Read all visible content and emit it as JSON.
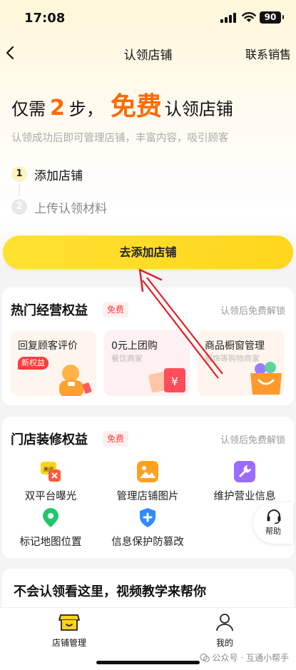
{
  "status_bar": {
    "time": "17:08",
    "battery": "90"
  },
  "nav": {
    "title": "认领店铺",
    "contact": "联系销售"
  },
  "hero": {
    "headline_pre": "仅需",
    "headline_num": "2",
    "headline_mid": "步，",
    "headline_free": "免费",
    "headline_post": "认领店铺",
    "subtitle": "认领成功后即可管理店铺，丰富内容，吸引顾客"
  },
  "steps": [
    {
      "num": "1",
      "label": "添加店铺"
    },
    {
      "num": "2",
      "label": "上传认领材料"
    }
  ],
  "cta": {
    "label": "去添加店铺"
  },
  "hot_benefits": {
    "title": "热门经营权益",
    "badge": "免费",
    "unlock": "认领后免费解锁",
    "tiles": [
      {
        "title": "回复顾客评价",
        "tag": "新权益"
      },
      {
        "title": "0元上团购",
        "subtitle": "餐饮商家"
      },
      {
        "title": "商品橱窗管理",
        "subtitle": "服饰等购物商家"
      }
    ]
  },
  "decor_benefits": {
    "title": "门店装修权益",
    "badge": "免费",
    "unlock": "认领后免费解锁",
    "items": [
      {
        "label": "双平台曝光",
        "icon": "dual-platform-icon",
        "icon_text": "美团"
      },
      {
        "label": "管理店铺图片",
        "icon": "image-icon"
      },
      {
        "label": "维护营业信息",
        "icon": "wrench-icon"
      },
      {
        "label": "标记地图位置",
        "icon": "map-pin-icon"
      },
      {
        "label": "信息保护防篡改",
        "icon": "shield-plus-icon"
      }
    ]
  },
  "help": {
    "label": "帮助"
  },
  "video_tip": {
    "text": "不会认领看这里，视频教学来帮你"
  },
  "tabs": [
    {
      "label": "店铺管理",
      "icon": "store-icon"
    },
    {
      "label": "我的",
      "icon": "user-icon"
    }
  ],
  "watermark": {
    "text": "公众号 · 互通小帮手"
  },
  "colors": {
    "accent": "#ff6a00",
    "cta": "#ffd61c",
    "badge": "#ff3b3b",
    "annotation": "#e0202a"
  }
}
